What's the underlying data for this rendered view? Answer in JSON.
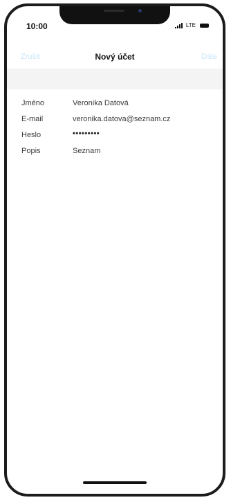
{
  "status_bar": {
    "time": "10:00",
    "network": "LTE",
    "icons": [
      "signal-icon",
      "battery-icon"
    ]
  },
  "nav": {
    "cancel_label": "Zrušit",
    "title": "Nový účet",
    "next_label": "Dále"
  },
  "form": {
    "rows": [
      {
        "label": "Jméno",
        "value": "Veronika Datová"
      },
      {
        "label": "E-mail",
        "value": "veronika.datova@seznam.cz"
      },
      {
        "label": "Heslo",
        "value": "•••••••••"
      },
      {
        "label": "Popis",
        "value": "Seznam"
      }
    ]
  },
  "colors": {
    "accent_disabled": "#c8e6fa",
    "text": "#3b3b3b",
    "band": "#f4f4f5"
  }
}
